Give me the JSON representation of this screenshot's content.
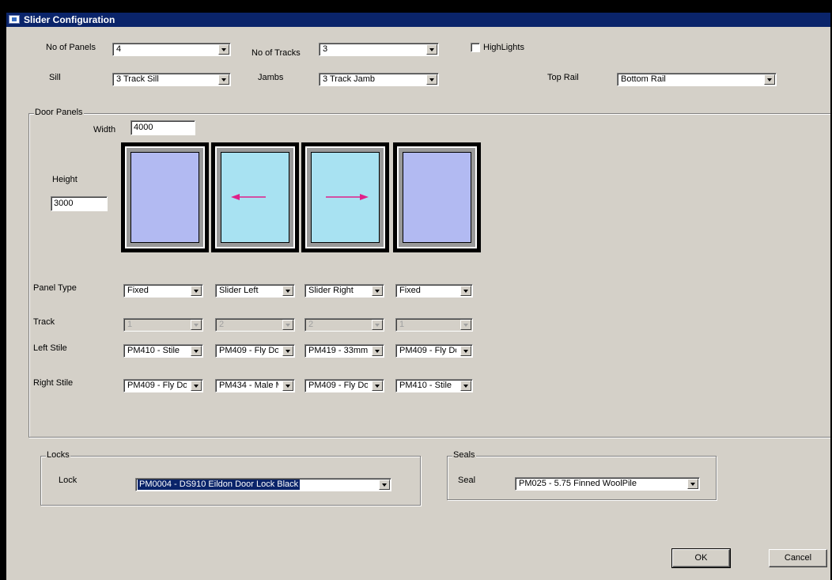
{
  "window": {
    "title": "Slider Configuration"
  },
  "top": {
    "no_of_panels_label": "No of Panels",
    "no_of_panels_value": "4",
    "no_of_tracks_label": "No of Tracks",
    "no_of_tracks_value": "3",
    "highlights_label": "HighLights",
    "highlights_checked": false,
    "sill_label": "Sill",
    "sill_value": "3 Track Sill",
    "jambs_label": "Jambs",
    "jambs_value": "3 Track Jamb",
    "top_rail_label": "Top Rail",
    "top_rail_value": "Bottom Rail"
  },
  "door_panels": {
    "group_title": "Door Panels",
    "width_label": "Width",
    "width_value": "4000",
    "height_label": "Height",
    "height_value": "3000",
    "panels": [
      {
        "type": "fixed",
        "arrow": "none"
      },
      {
        "type": "slider",
        "arrow": "left"
      },
      {
        "type": "slider",
        "arrow": "right"
      },
      {
        "type": "fixed",
        "arrow": "none"
      }
    ],
    "arrow_color": "#e0208a",
    "row_labels": {
      "panel_type": "Panel Type",
      "track": "Track",
      "left_stile": "Left Stile",
      "right_stile": "Right Stile"
    },
    "panel_type": [
      "Fixed",
      "Slider Left",
      "Slider Right",
      "Fixed"
    ],
    "track": [
      "1",
      "2",
      "2",
      "1"
    ],
    "left_stile": [
      "PM410 - Stile",
      "PM409 - Fly Do",
      "PM419 - 33mm",
      "PM409 - Fly Do"
    ],
    "right_stile": [
      "PM409 - Fly Do",
      "PM434 - Male M",
      "PM409 - Fly Do",
      "PM410 - Stile"
    ]
  },
  "locks": {
    "group_title": "Locks",
    "lock_label": "Lock",
    "lock_value": "PM0004 - DS910 Eildon Door Lock Black"
  },
  "seals": {
    "group_title": "Seals",
    "seal_label": "Seal",
    "seal_value": "PM025 - 5.75 Finned WoolPile"
  },
  "buttons": {
    "ok": "OK",
    "cancel": "Cancel"
  },
  "colors": {
    "dialog_bg": "#d4d0c8",
    "titlebar": "#0a246a",
    "fixed_glass": "#b2baf2",
    "slider_glass": "#a8e2f2",
    "selection": "#0a246a"
  }
}
